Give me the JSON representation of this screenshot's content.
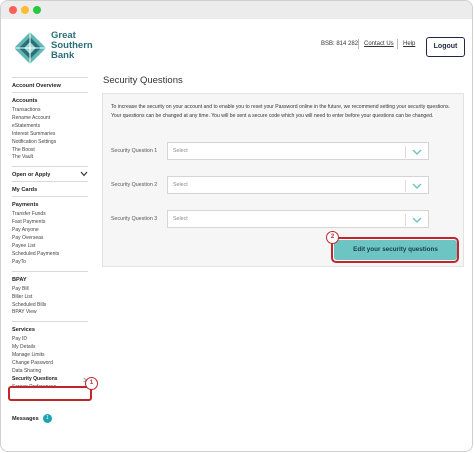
{
  "header": {
    "logo_text": "Great Southern Bank",
    "bsb": "BSB: 814 282",
    "contact_us": "Contact Us",
    "help": "Help",
    "logout": "Logout"
  },
  "sidebar": {
    "account_overview": "Account Overview",
    "accounts": {
      "title": "Accounts",
      "items": [
        "Transactions",
        "Rename Account",
        "eStatements",
        "Interest Summaries",
        "Notification Settings",
        "The Boost",
        "The Vault"
      ]
    },
    "open_or_apply": "Open or Apply",
    "my_cards": "My Cards",
    "payments": {
      "title": "Payments",
      "items": [
        "Transfer Funds",
        "Fast Payments",
        "Pay Anyone",
        "Pay Overseas",
        "Payee List",
        "Scheduled Payments",
        "PayTo"
      ]
    },
    "bpay": {
      "title": "BPAY",
      "items": [
        "Pay Bill",
        "Biller List",
        "Scheduled Bills",
        "BPAY View"
      ]
    },
    "services": {
      "title": "Services",
      "items": [
        "Pay ID",
        "My Details",
        "Manage Limits",
        "Change Password",
        "Data Sharing",
        "Security Questions",
        "Screen Preferences"
      ]
    },
    "messages": {
      "label": "Messages",
      "count": "1"
    }
  },
  "main": {
    "title": "Security Questions",
    "intro": "To increase the security on your account and to enable you to reset your Password online in the future, we recommend setting your security questions. Your questions can be changed at any time. You will be sent a secure code which you will need to enter before your questions can be changed.",
    "questions": [
      {
        "label": "Security Question 1",
        "value": "Select"
      },
      {
        "label": "Security Question 2",
        "value": "Select"
      },
      {
        "label": "Security Question 3",
        "value": "Select"
      }
    ],
    "edit_button": "Edit your security questions"
  },
  "annotations": {
    "step1": "1",
    "step2": "2"
  },
  "colors": {
    "accent": "#6dc5c3",
    "highlight": "#c0262c",
    "brand": "#2a6f78"
  }
}
